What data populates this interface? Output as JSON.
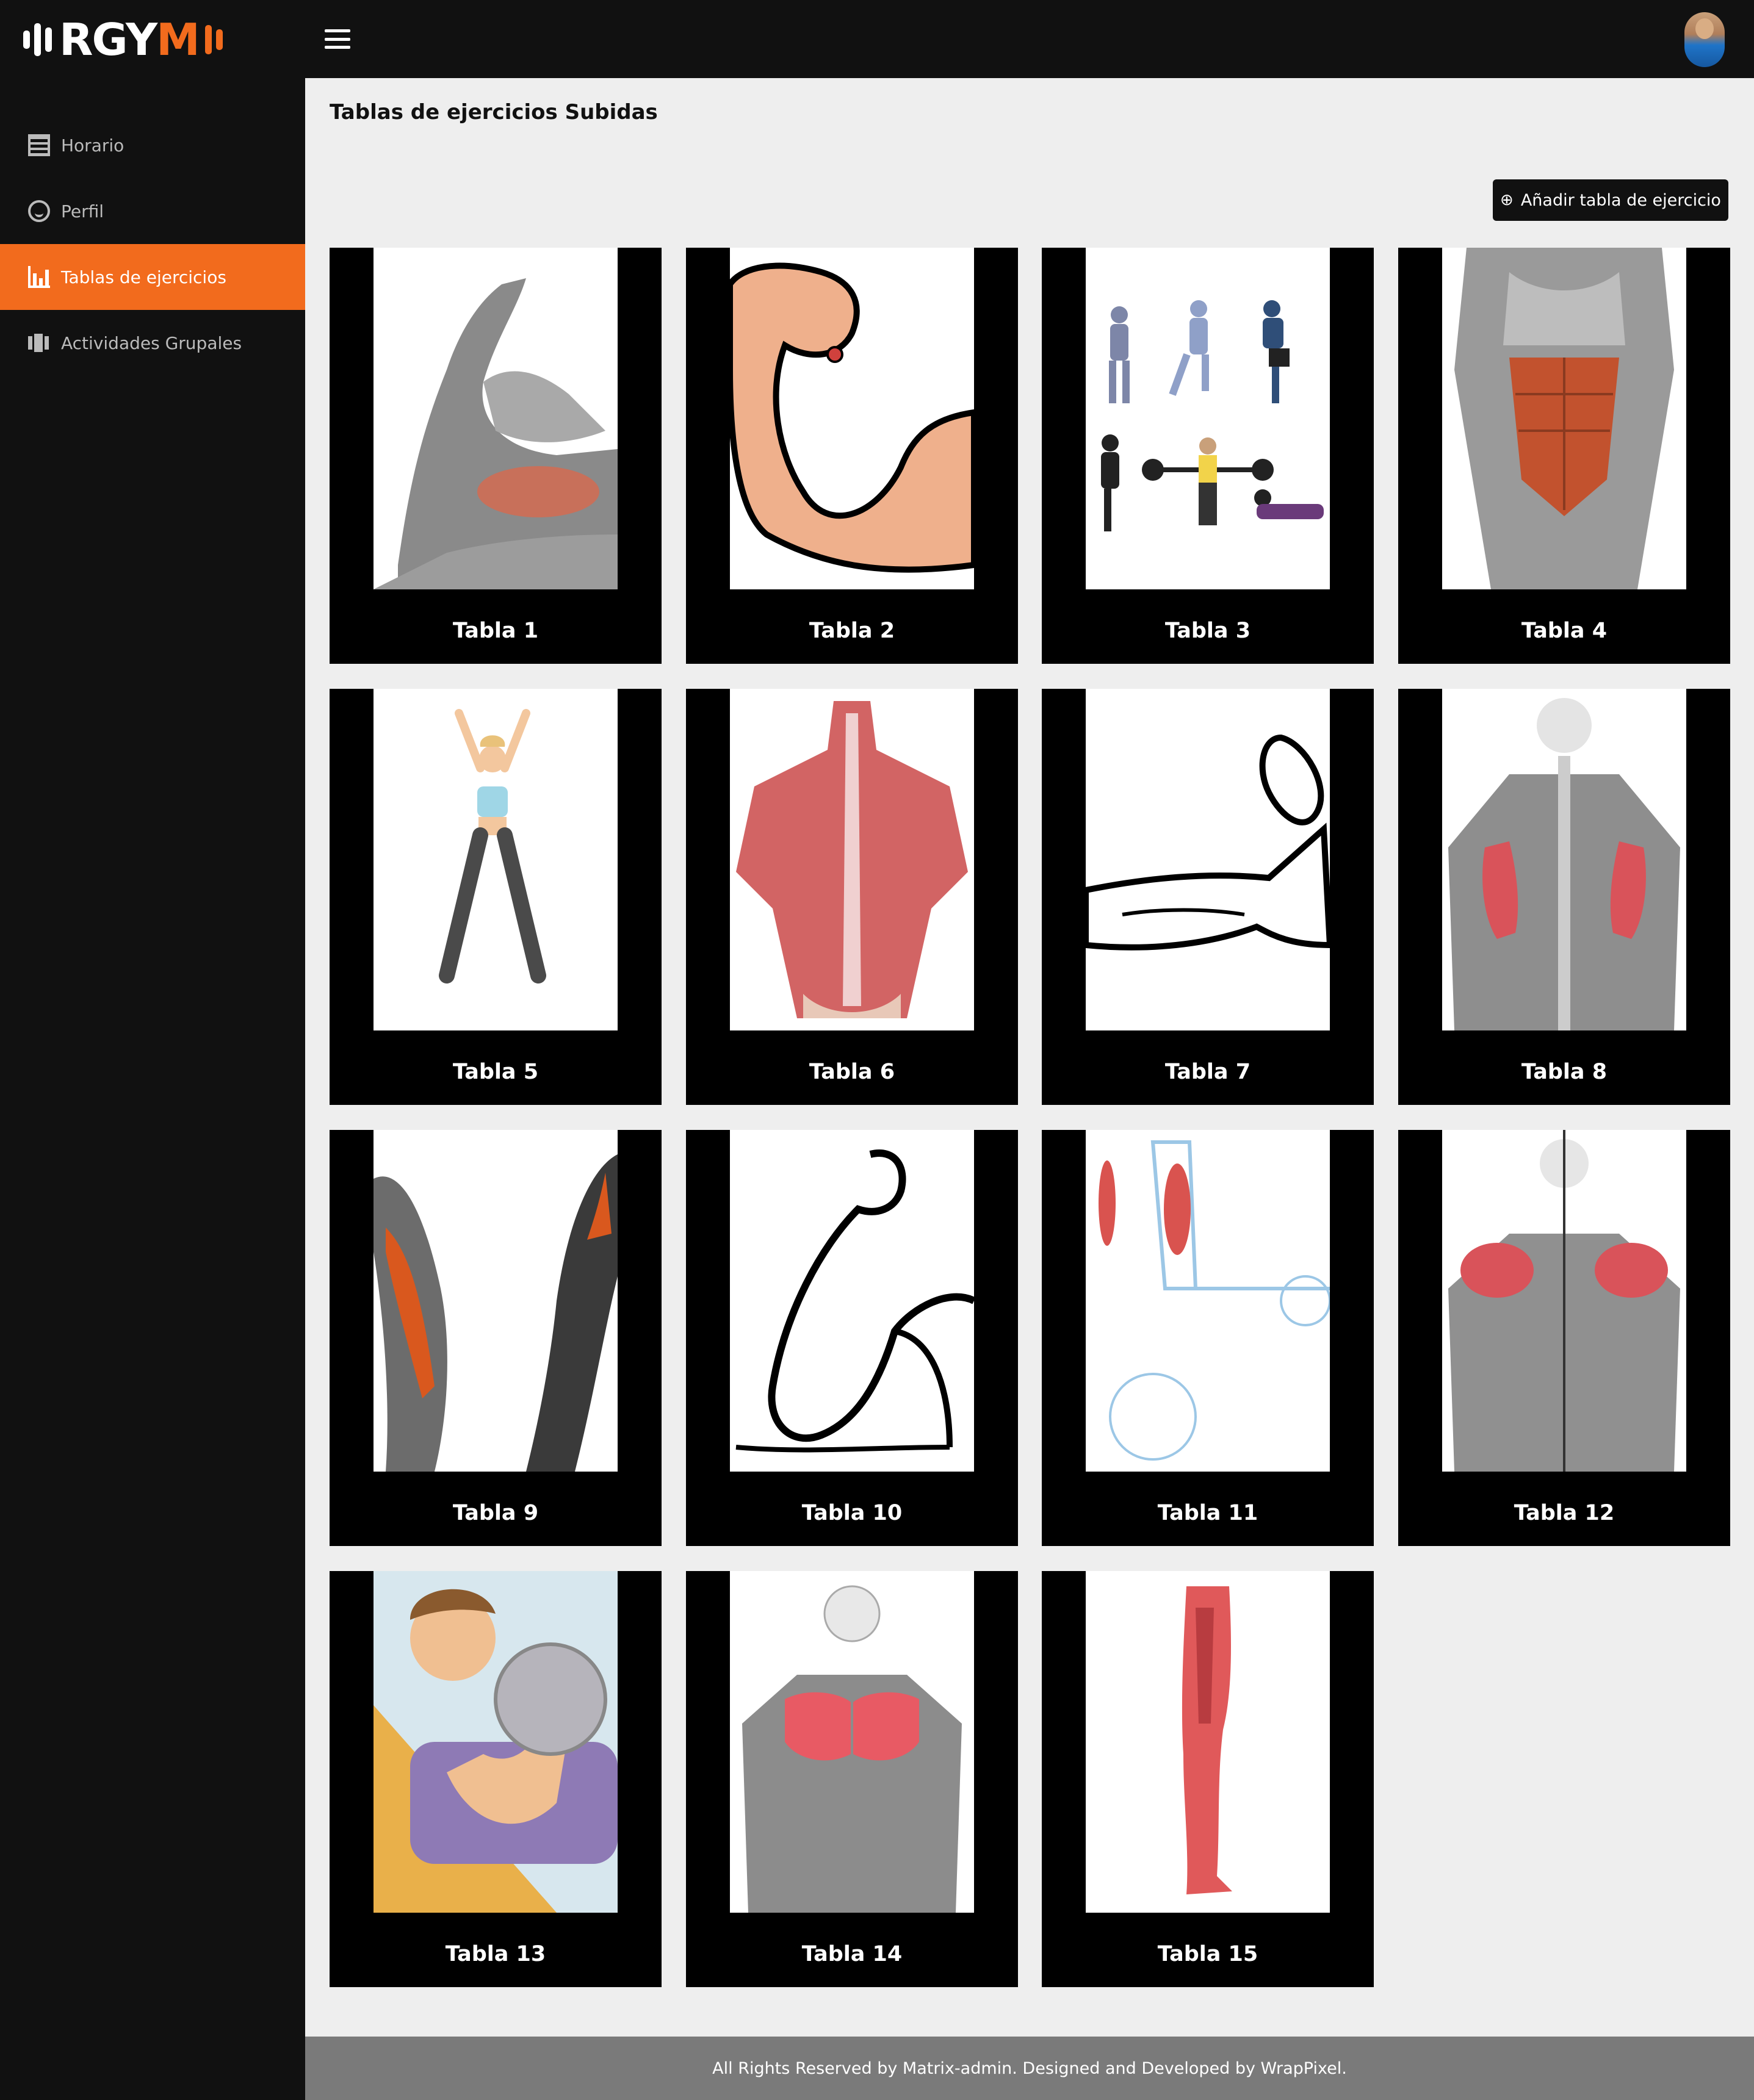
{
  "brand": {
    "logo_text_a": "RGY",
    "logo_text_b": "M",
    "accent_color": "#f26b1d"
  },
  "header": {
    "menu_icon": "hamburger-icon",
    "avatar": "user-avatar"
  },
  "sidebar": {
    "items": [
      {
        "label": "Horario",
        "icon": "calendar-icon",
        "active": false
      },
      {
        "label": "Perfil",
        "icon": "smile-icon",
        "active": false
      },
      {
        "label": "Tablas de ejercicios",
        "icon": "bar-chart-icon",
        "active": true
      },
      {
        "label": "Actividades Grupales",
        "icon": "group-icon",
        "active": false
      }
    ]
  },
  "main": {
    "title": "Tablas de ejercicios Subidas",
    "add_button": {
      "icon": "plus-circle-icon",
      "label": "Añadir tabla de ejercicio"
    },
    "cards": [
      {
        "label": "Tabla 1"
      },
      {
        "label": "Tabla 2"
      },
      {
        "label": "Tabla 3"
      },
      {
        "label": "Tabla 4"
      },
      {
        "label": "Tabla 5"
      },
      {
        "label": "Tabla 6"
      },
      {
        "label": "Tabla 7"
      },
      {
        "label": "Tabla 8"
      },
      {
        "label": "Tabla 9"
      },
      {
        "label": "Tabla 10"
      },
      {
        "label": "Tabla 11"
      },
      {
        "label": "Tabla 12"
      },
      {
        "label": "Tabla 13"
      },
      {
        "label": "Tabla 14"
      },
      {
        "label": "Tabla 15"
      }
    ]
  },
  "footer": {
    "text": "All Rights Reserved by Matrix-admin. Designed and Developed by WrapPixel."
  }
}
